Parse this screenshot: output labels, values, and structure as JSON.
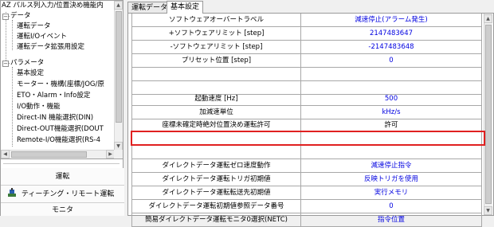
{
  "tree": {
    "nodes": [
      {
        "label": "AZ パルス列入力/位置決め機能内",
        "level": 0,
        "toggle": "−"
      },
      {
        "label": "データ",
        "level": 1,
        "toggle": "−"
      },
      {
        "label": "運転データ",
        "level": 2
      },
      {
        "label": "運転I/Oイベント",
        "level": 2
      },
      {
        "label": "運転データ拡張用設定",
        "level": 2
      },
      {
        "label": "パラメータ",
        "level": 1,
        "toggle": "−"
      },
      {
        "label": "基本設定",
        "level": 2
      },
      {
        "label": "モーター・機構(座標/JOG/原",
        "level": 2
      },
      {
        "label": "ETO・Alarm・Info設定",
        "level": 2
      },
      {
        "label": "I/O動作・機能",
        "level": 2
      },
      {
        "label": "Direct-IN 機能選択(DIN)",
        "level": 2
      },
      {
        "label": "Direct-OUT機能選択(DOUT",
        "level": 2
      },
      {
        "label": "Remote-I/O機能選択(RS-4",
        "level": 2
      }
    ]
  },
  "nav": {
    "operation_label": "運転",
    "teaching_label": "ティーチング・リモート運転",
    "monitor_label": "モニタ"
  },
  "tabs": [
    {
      "label": "運転データ",
      "active": false
    },
    {
      "label": "基本設定",
      "active": true
    }
  ],
  "grid": {
    "rows": [
      {
        "label": "ソフトウェアオーバートラベル",
        "value": "減速停止(アラーム発生)"
      },
      {
        "label": "+ソフトウェアリミット [step]",
        "value": "2147483647"
      },
      {
        "label": "-ソフトウェアリミット [step]",
        "value": "-2147483648"
      },
      {
        "label": "プリセット位置 [step]",
        "value": "0"
      },
      {
        "label": "",
        "value": ""
      },
      {
        "label": "",
        "value": ""
      },
      {
        "label": "起動速度 [Hz]",
        "value": "500"
      },
      {
        "label": "加減速単位",
        "value": "kHz/s"
      },
      {
        "label": "座標未確定時絶対位置決め運転許可",
        "value": "許可",
        "highlight": true
      },
      {
        "label": "",
        "value": ""
      },
      {
        "label": "",
        "value": ""
      },
      {
        "label": "ダイレクトデータ運転ゼロ速度動作",
        "value": "減速停止指令"
      },
      {
        "label": "ダイレクトデータ運転トリガ初期値",
        "value": "反映トリガを使用"
      },
      {
        "label": "ダイレクトデータ運転転送先初期値",
        "value": "実行メモリ"
      },
      {
        "label": "ダイレクトデータ運転初期値参照データ番号",
        "value": "0"
      },
      {
        "label": "簡易ダイレクトデータ運転モニタ0選択(NETC)",
        "value": "指令位置"
      }
    ]
  },
  "colors": {
    "highlight": "#e02020",
    "value_text": "#0000e0"
  }
}
